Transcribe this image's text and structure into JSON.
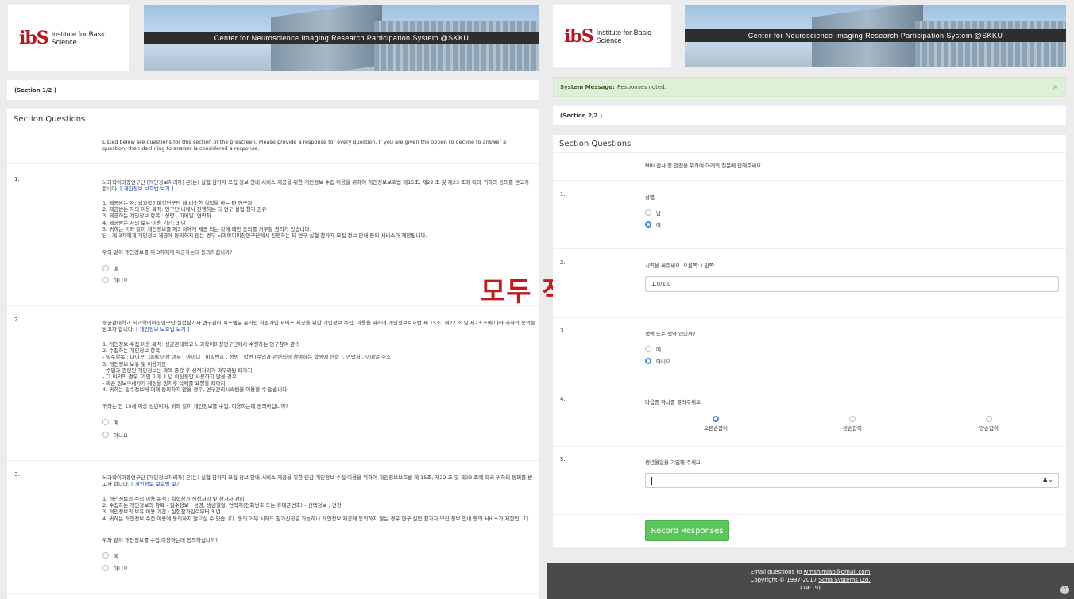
{
  "left": {
    "logo_mark": "ibS",
    "logo_text": "Institute for Basic Science",
    "banner_title": "Center for Neuroscience Imaging Research Participation System @SKKU",
    "section_label": "(Section 1/2 )",
    "section_title": "Section Questions",
    "intro": "Listed below are questions for this section of the prescreen. Please provide a response for every question. If you are given the option to decline to answer a question, then declining to answer is considered a response.",
    "questions": [
      {
        "num": "1.",
        "lead": "뇌과학이미징연구단 [개인정보처리자] 은(는) 실험 참가자 모집 정보 안내 서비스 제공을 위한 개인정보 수집·이용을 위하여 개인정보보호법 제15조, 제22 조 및 제23 조에 따라 귀하의 동의를 받고자 합니다.",
        "link": "[ 개인정보 보호법 보기 ]",
        "body": [
          "1. 제공받는 자: 뇌과학이미징연구단 내 비슷한 실험을 하는 타 연구자",
          "2. 제공받는 자의 이용 목적: 연구단 내에서 진행하는 타 연구 실험 참가 권유",
          "3. 제공하는 개인정보 항목 : 성명 , 이메일, 연락처",
          "4. 제공받는 자의 보유·이용 기간: 3 년",
          "5. 귀하는 이와 같이 개인정보를 제3 자에게 제공 되는 것에 대한 동의를 거부할 권리가 있습니다.",
          "단 , 제 3자에게 개인정보 제공에 동의하지 않는 경우 뇌과학이미징연구단에서 진행하는 타 연구 실험 참가자 모집 정보 안내 등의 서비스가 제한됩니다."
        ],
        "ask": "위와 같이 개인정보를 제 3자에게 제공하는데 동의하십니까?",
        "opt_yes": "예",
        "opt_no": "아니오"
      },
      {
        "num": "2.",
        "lead": "성균관대학교 뇌과학이미징연구단 실험참가자 연구관리 시스템은 온라인 회원가입 서비스 제공을 위한 개인정보 수집, 이용을 위하여 개인정보보호법 제 15조, 제22 조 및 제23 조에 따라 귀하의 동의를 받고자 합니다.",
        "link": "[ 개인정보 보호법 보기 ]",
        "body": [
          "1. 개인정보 수집.이용 목적: 성균관대학교 뇌과학이미징연구단에서 수행하는 연구참여 관리",
          "2. 수집하는 개인정보 항목",
          "- 필수항목 : 나이 만 18세 이상 여부 , 아이디 , 비밀번호 , 성명 , 학번 (수업과 관련되어 참여하는 학생에 한함 ), 연락처 , 이메일 주소",
          "3. 개인정보 보유 및 이용기간",
          "- 수업과 관련된 개인정보는 과목 종강 후 성적처리가 마무리될 때까지",
          "- 그 이외의 경우, 가입 이후 1 년 이상동안 사용하지 않을 경우",
          "- 혹은 정보주체가가 계정을 정지후 삭제를 요청할 때까지",
          "4. 귀하는 필수정보에 대해 동의하지 않을 경우, 연구관리시스템을 이용할 수 없습니다."
        ],
        "ask": "귀하는 만 18세 이상 성년이며, 위와 같이 개인정보를 수집. 이용하는데 동의하십니까?",
        "opt_yes": "예",
        "opt_no": "아니오"
      },
      {
        "num": "3.",
        "lead": "뇌과학이미징연구단 [개인정보처리자] 은(는) 실험 참가자 모집 정보 안내 서비스 제공을 위한 민감 개인정보 수집·이용을 위하여 개인정보보호법 제 15조, 제22 조 및 제23 조에 따라 귀하의 동의를 받고자 합니다.",
        "link": "[ 개인정보 보호법 보기 ]",
        "body": [
          "1. 개인정보의 수집.이용 목적 : 실험참가 신청처리 및 참가자 관리",
          "2. 수집하는 개인정보의 항목 - 필수정보 : 성명, 생년월일, 연락처(전화번호 또는 휴대폰번호) - 선택정보 : 건강",
          "3. 개인정보의 보유·이용 기간 : 실험참가일로부터 3 년",
          "4. 귀하는 개인정보 수집·이용에 동의하지 않으실 수 있습니다. 동의 거부 시에도 참가신청은 가능하나 개인정보 제공에 동의하지 않는 경우 연구 실험 참가자 모집 정보 안내 등의 서비스가 제한됩니다."
        ],
        "ask": "위와 같이 개인정보를 수집.이용하는데 동의하십니까?",
        "opt_yes": "예",
        "opt_no": "아니오"
      }
    ]
  },
  "overlay_text": "모두 작성후",
  "right": {
    "logo_mark": "ibS",
    "logo_text": "Institute for Basic Science",
    "banner_title": "Center for Neuroscience Imaging Research Participation System @SKKU",
    "system_message_label": "System Message:",
    "system_message": "Responses noted.",
    "close": "×",
    "section_label": "(Section 2/2 )",
    "section_title": "Section Questions",
    "intro": "MRI 검사 중 안전을 위하여 아래의 질문에 답해주세요.",
    "q1": {
      "num": "1.",
      "label": "성별",
      "opt_a": "남",
      "opt_b": "여",
      "selected": "여"
    },
    "q2": {
      "num": "2.",
      "label": "시력을 써주세요. 오른쪽: / 왼쪽:",
      "value": "1.0/1.0"
    },
    "q3": {
      "num": "3.",
      "label": "색맹 또는 색약 입니까?",
      "opt_a": "예",
      "opt_b": "아니오",
      "selected": "아니오"
    },
    "q4": {
      "num": "4.",
      "label": "다음중 하나를 골라주세요.",
      "opt_a": "오른손잡이",
      "opt_b": "왼손잡이",
      "opt_c": "양손잡이",
      "selected": "오른손잡이"
    },
    "q5": {
      "num": "5.",
      "label": "생년월일을 기입해 주세요",
      "value": ""
    },
    "submit": "Record Responses",
    "footer": {
      "line1_prefix": "Email questions to ",
      "email": "wmshimlab@gmail.com",
      "line2_prefix": "Copyright © 1997-2017 ",
      "company": "Sona Systems Ltd.",
      "time": "(14:19)"
    }
  },
  "colors": {
    "accent": "#3d8ee2",
    "button": "#5bc75b",
    "alert_bg": "#dff0d8",
    "overlay": "#c01a1a",
    "footer": "#4a4a4a"
  }
}
